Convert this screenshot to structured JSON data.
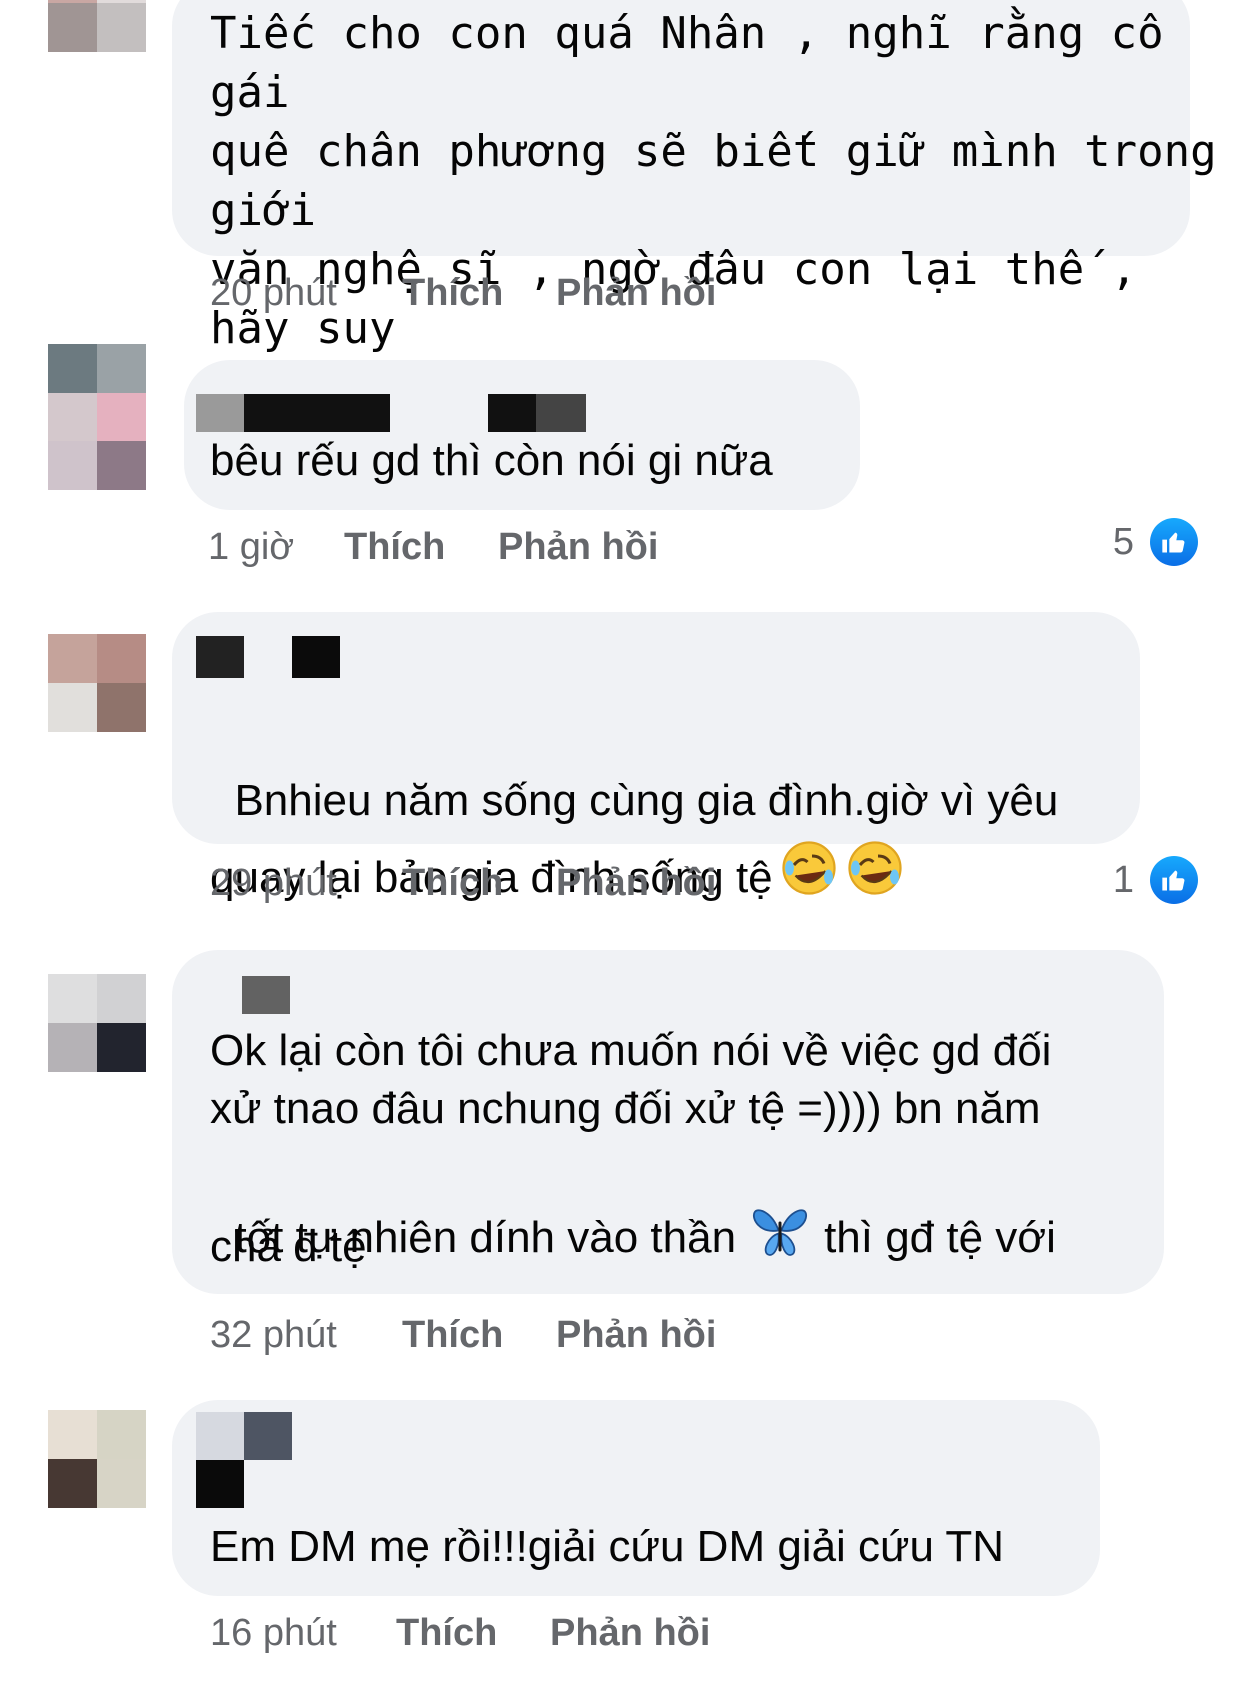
{
  "comments": [
    {
      "text": "Tiếc cho con quá Nhân , nghĩ rằng cô gái\nquê chân phương sẽ biết giữ mình trong giới\nvăn nghệ sĩ , ngờ đâu con lại thế , hãy suy\nnghĩ lại nha con ...",
      "time": "20 phút",
      "like_label": "Thích",
      "reply_label": "Phản hồi"
    },
    {
      "text": "bêu rếu gd thì còn nói gi nữa",
      "time": "1 giờ",
      "like_label": "Thích",
      "reply_label": "Phản hồi",
      "reaction_count": "5"
    },
    {
      "text": "Bnhieu năm sống cùng gia đình.giờ vì yêu\nquay lại bảo gia đình sống tệ",
      "emoji": [
        "rolling-on-floor-laughing",
        "rolling-on-floor-laughing"
      ],
      "time": "29 phút",
      "like_label": "Thích",
      "reply_label": "Phản hồi",
      "reaction_count": "1"
    },
    {
      "text_lines": [
        "Ok lại còn tôi chưa muốn nói về việc gd đối",
        "xử tnao đâu nchung đối xử tệ =)))) bn năm",
        "tốt tự nhiên dính vào thần",
        "thì gđ tệ với",
        "chả đ tệ"
      ],
      "emoji": [
        "butterfly"
      ],
      "time": "32 phút",
      "like_label": "Thích",
      "reply_label": "Phản hồi"
    },
    {
      "text": "Em DM mẹ rồi!!!giải cứu DM giải cứu TN",
      "time": "16 phút",
      "like_label": "Thích",
      "reply_label": "Phản hồi"
    }
  ],
  "colors": {
    "bubble": "#f0f2f5",
    "meta": "#65676b",
    "text": "#050505",
    "like": "#1877f2"
  },
  "icons": {
    "like": "thumbs-up-icon"
  }
}
